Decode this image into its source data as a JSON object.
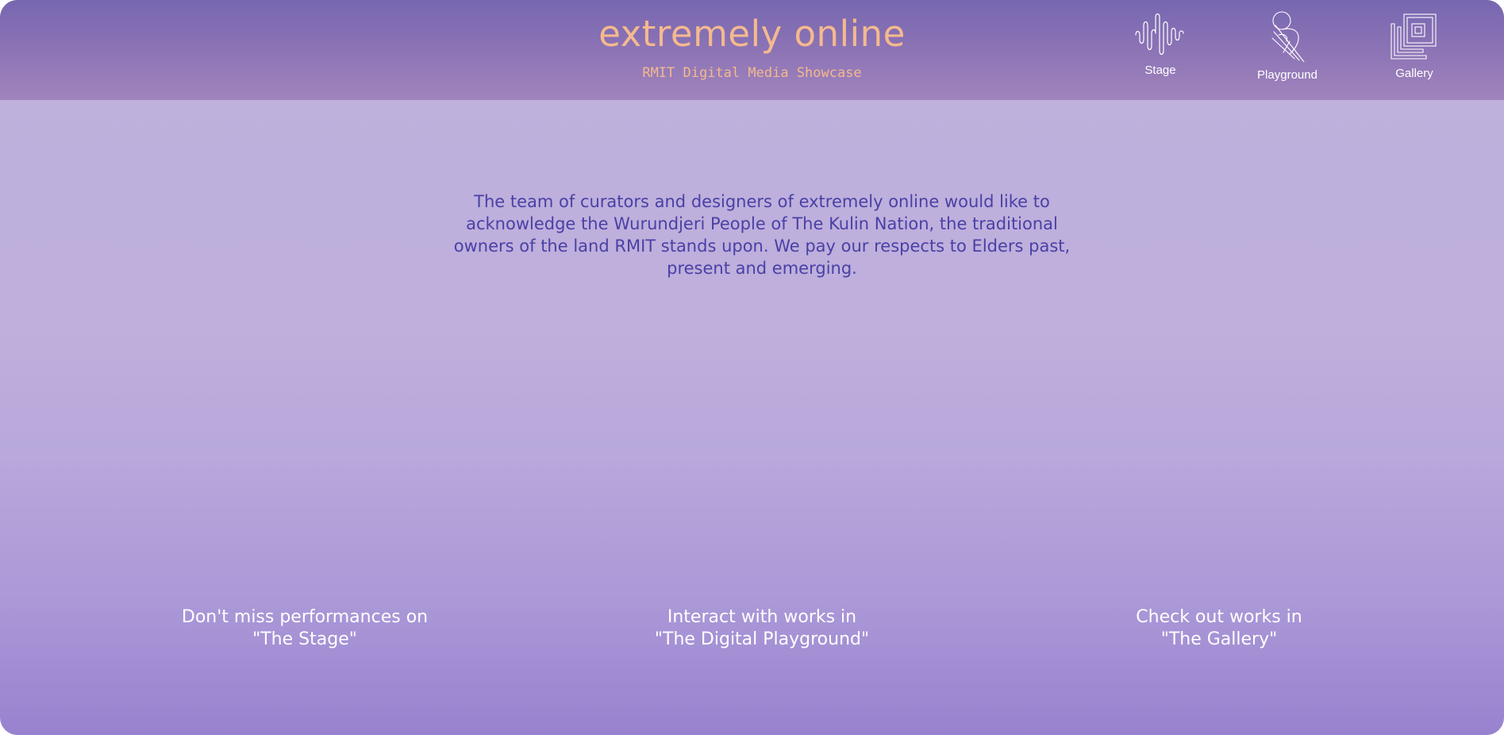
{
  "header": {
    "title": "extremely online",
    "subtitle": "RMIT Digital Media Showcase"
  },
  "nav": {
    "items": [
      {
        "label": "Stage",
        "icon": "waveform-icon"
      },
      {
        "label": "Playground",
        "icon": "playground-icon"
      },
      {
        "label": "Gallery",
        "icon": "gallery-frames-icon"
      }
    ]
  },
  "acknowledgement": {
    "text": "The team of curators and designers of extremely online would like to acknowledge the Wurundjeri People of The Kulin Nation, the traditional owners of the land RMIT stands upon. We pay our respects to Elders past, present and emerging."
  },
  "features": [
    {
      "line1": "Don't miss performances on",
      "line2": "\"The Stage\""
    },
    {
      "line1": "Interact with works in",
      "line2": "\"The Digital Playground\""
    },
    {
      "line1": "Check out works in",
      "line2": "\"The Gallery\""
    }
  ],
  "colors": {
    "accent": "#f4b98e",
    "header_top": "#7767b0",
    "header_bottom": "#a184bc",
    "body_text": "#4a40a6",
    "background": "#bfb0dc"
  }
}
